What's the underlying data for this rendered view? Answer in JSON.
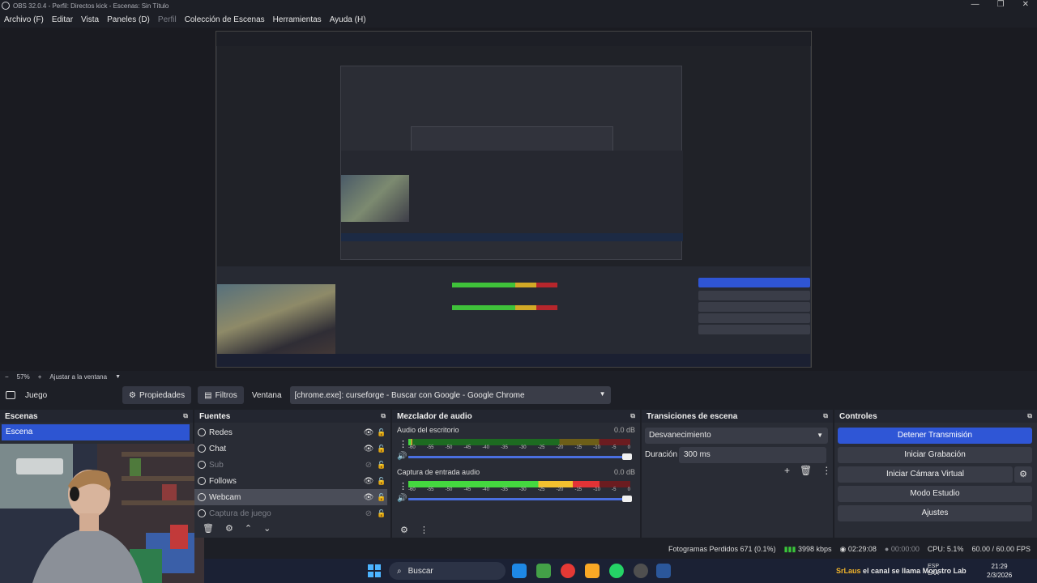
{
  "window": {
    "title": "OBS 32.0.4 - Perfil: Directos kick - Escenas: Sin Título",
    "controls": [
      "—",
      "❐",
      "✕"
    ]
  },
  "menu": [
    "Archivo (F)",
    "Editar",
    "Vista",
    "Paneles (D)",
    "Perfil",
    "Colección de Escenas",
    "Herramientas",
    "Ayuda (H)"
  ],
  "zoom": {
    "minus": "−",
    "value": "57%",
    "plus": "+",
    "fit": "Ajustar a la ventana"
  },
  "toolbar": {
    "source_name": "Juego",
    "properties": "Propiedades",
    "filters": "Filtros",
    "window_label": "Ventana",
    "window_value": "[chrome.exe]: curseforge - Buscar con Google - Google Chrome"
  },
  "scenes": {
    "title": "Escenas",
    "items": [
      "Escena"
    ]
  },
  "sources": {
    "title": "Fuentes",
    "items": [
      {
        "label": "Redes",
        "visible": true
      },
      {
        "label": "Chat",
        "visible": true
      },
      {
        "label": "Sub",
        "visible": false
      },
      {
        "label": "Follows",
        "visible": true
      },
      {
        "label": "Webcam",
        "visible": true
      },
      {
        "label": "Captura de juego",
        "visible": false
      }
    ]
  },
  "mixer": {
    "title": "Mezclador de audio",
    "channels": [
      {
        "name": "Audio del escritorio",
        "db": "0.0 dB",
        "level": 0.02
      },
      {
        "name": "Captura de entrada audio",
        "db": "0.0 dB",
        "level": 0.86
      }
    ],
    "ticks": [
      "-60",
      "-55",
      "-50",
      "-45",
      "-40",
      "-35",
      "-30",
      "-25",
      "-20",
      "-15",
      "-10",
      "-5",
      "0"
    ]
  },
  "transitions": {
    "title": "Transiciones de escena",
    "selected": "Desvanecimiento",
    "duration_label": "Duración",
    "duration_value": "300 ms"
  },
  "controls": {
    "title": "Controles",
    "stop_stream": "Detener Transmisión",
    "start_recording": "Iniciar Grabación",
    "start_virtual_cam": "Iniciar Cámara Virtual",
    "studio_mode": "Modo Estudio",
    "settings": "Ajustes"
  },
  "status": {
    "dropped": "Fotogramas Perdidos 671 (0.1%)",
    "kbps": "3998 kbps",
    "stream_time": "02:29:08",
    "rec_time": "00:00:00",
    "cpu": "CPU: 5.1%",
    "fps": "60.00 / 60.00 FPS"
  },
  "taskbar": {
    "search": "Buscar",
    "brand_name": "SrLaus",
    "brand_text": "el canal se llama Monstro Lab",
    "lang": "ESP",
    "lang2": "LAA",
    "time": "21:29",
    "date": "2/3/2026"
  },
  "colors": {
    "accent": "#2f56d6",
    "panel": "#292c35",
    "meter_green": "#44d83f",
    "meter_yellow": "#f3c12f",
    "meter_red": "#e23336"
  }
}
